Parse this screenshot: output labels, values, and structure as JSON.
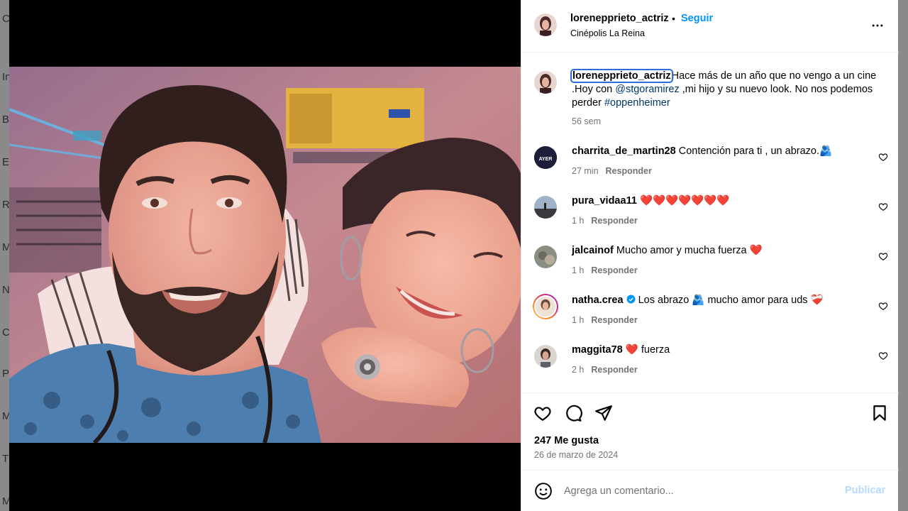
{
  "background_page": {
    "letters": [
      "Co",
      "In",
      "B",
      "E",
      "R",
      "M",
      "N",
      "C",
      "P",
      "M",
      "T",
      "M"
    ]
  },
  "post": {
    "author": "lorenepprieto_actriz",
    "follow_label": "Seguir",
    "separator": "•",
    "location": "Cinépolis La Reina",
    "caption": {
      "username": "lorenepprieto_actriz",
      "text_1": "Hace más de un año que no vengo a un cine .Hoy con ",
      "mention": "@stgoramirez",
      "text_2": " ,mi hijo y su nuevo look. No nos podemos perder ",
      "hashtag": "#oppenheimer",
      "time": "56 sem"
    },
    "likes": "247 Me gusta",
    "date": "26 de marzo de 2024"
  },
  "comments": [
    {
      "username": "charrita_de_martin28",
      "text": "Contención para ti , un abrazo.🫂",
      "time": "27 min",
      "reply": "Responder",
      "avatar_label": "AYER"
    },
    {
      "username": "pura_vidaa11",
      "text": "❤️❤️❤️❤️❤️❤️❤️",
      "time": "1 h",
      "reply": "Responder"
    },
    {
      "username": "jalcainof",
      "text": "Mucho amor y mucha fuerza ❤️",
      "time": "1 h",
      "reply": "Responder"
    },
    {
      "username": "natha.crea",
      "text": "Los abrazo 🫂 mucho amor para uds ❤️‍🩹",
      "time": "1 h",
      "reply": "Responder",
      "verified": true
    },
    {
      "username": "maggita78",
      "text": "❤️ fuerza",
      "time": "2 h",
      "reply": "Responder"
    }
  ],
  "add_comment": {
    "placeholder": "Agrega un comentario...",
    "post_label": "Publicar"
  },
  "colors": {
    "link_blue": "#0095f6",
    "mention_blue": "#00376b",
    "meta_gray": "#737373",
    "post_disabled": "#b3dbff",
    "verified": "#0095f6"
  },
  "icons": {
    "more": "more-horizontal-icon",
    "like": "heart-icon",
    "comment": "comment-icon",
    "share": "paper-plane-icon",
    "save": "bookmark-icon",
    "emoji": "emoji-icon",
    "comment_like": "small-heart-icon",
    "verified": "verified-badge-icon"
  }
}
